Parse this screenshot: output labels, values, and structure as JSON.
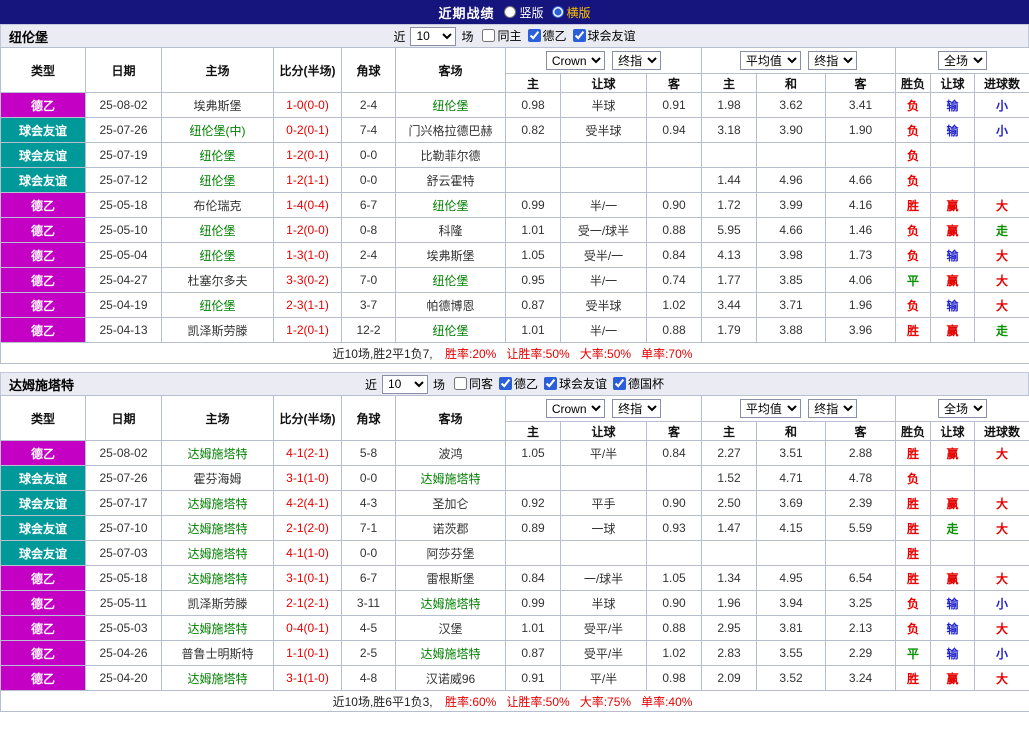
{
  "topbar": {
    "title": "近期战绩",
    "selected_color": "#ffc000",
    "radios": [
      {
        "key": "vertical",
        "label": "竖版",
        "checked": false
      },
      {
        "key": "horizontal",
        "label": "横版",
        "checked": true
      }
    ]
  },
  "headers": {
    "type": "类型",
    "date": "日期",
    "home": "主场",
    "score": "比分(半场)",
    "corner": "角球",
    "away": "客场",
    "sub": [
      "主",
      "让球",
      "客",
      "主",
      "和",
      "客",
      "胜负",
      "让球",
      "进球数"
    ]
  },
  "colors": {
    "league": {
      "de2": "#c400c4",
      "fr": "#009999"
    },
    "focus": "#008000",
    "score": "#e60000",
    "odds": "#333333",
    "red": "#e60000",
    "blue": "#2222cc",
    "green": "#089000"
  },
  "sections": [
    {
      "team": "纽伦堡",
      "filter": {
        "prefix": "近",
        "suffix": "场",
        "count_options": [
          "10"
        ],
        "checkboxes": [
          {
            "label": "同主",
            "checked": false
          },
          {
            "label": "德乙",
            "checked": true
          },
          {
            "label": "球会友谊",
            "checked": true
          }
        ]
      },
      "selects": {
        "bookmaker": [
          "Crown"
        ],
        "final": [
          "终指"
        ],
        "average": [
          "平均值"
        ],
        "final2": [
          "终指"
        ],
        "full": [
          "全场"
        ]
      },
      "rows": [
        {
          "lt": "de2",
          "league": "德乙",
          "date": "25-08-02",
          "home": "埃弗斯堡",
          "hf": false,
          "score": "1-0(0-0)",
          "corner": "2-4",
          "away": "纽伦堡",
          "af": true,
          "ah": "0.98",
          "line": "半球",
          "aa": "0.91",
          "eh": "1.98",
          "ed": "3.62",
          "ea": "3.41",
          "r1": [
            "负",
            "red"
          ],
          "r2": [
            "输",
            "blue"
          ],
          "r3": [
            "小",
            "blue"
          ]
        },
        {
          "lt": "fr",
          "league": "球会友谊",
          "date": "25-07-26",
          "home": "纽伦堡(中)",
          "hf": true,
          "score": "0-2(0-1)",
          "corner": "7-4",
          "away": "门兴格拉德巴赫",
          "af": false,
          "ah": "0.82",
          "line": "受半球",
          "aa": "0.94",
          "eh": "3.18",
          "ed": "3.90",
          "ea": "1.90",
          "r1": [
            "负",
            "red"
          ],
          "r2": [
            "输",
            "blue"
          ],
          "r3": [
            "小",
            "blue"
          ]
        },
        {
          "lt": "fr",
          "league": "球会友谊",
          "date": "25-07-19",
          "home": "纽伦堡",
          "hf": true,
          "score": "1-2(0-1)",
          "corner": "0-0",
          "away": "比勒菲尔德",
          "af": false,
          "ah": "",
          "line": "",
          "aa": "",
          "eh": "",
          "ed": "",
          "ea": "",
          "r1": [
            "负",
            "red"
          ],
          "r2": null,
          "r3": null
        },
        {
          "lt": "fr",
          "league": "球会友谊",
          "date": "25-07-12",
          "home": "纽伦堡",
          "hf": true,
          "score": "1-2(1-1)",
          "corner": "0-0",
          "away": "舒云霍特",
          "af": false,
          "ah": "",
          "line": "",
          "aa": "",
          "eh": "1.44",
          "ed": "4.96",
          "ea": "4.66",
          "r1": [
            "负",
            "red"
          ],
          "r2": null,
          "r3": null
        },
        {
          "lt": "de2",
          "league": "德乙",
          "date": "25-05-18",
          "home": "布伦瑞克",
          "hf": false,
          "score": "1-4(0-4)",
          "corner": "6-7",
          "away": "纽伦堡",
          "af": true,
          "ah": "0.99",
          "line": "半/一",
          "aa": "0.90",
          "eh": "1.72",
          "ed": "3.99",
          "ea": "4.16",
          "r1": [
            "胜",
            "red"
          ],
          "r2": [
            "赢",
            "red"
          ],
          "r3": [
            "大",
            "red"
          ]
        },
        {
          "lt": "de2",
          "league": "德乙",
          "date": "25-05-10",
          "home": "纽伦堡",
          "hf": true,
          "score": "1-2(0-0)",
          "corner": "0-8",
          "away": "科隆",
          "af": false,
          "ah": "1.01",
          "line": "受一/球半",
          "aa": "0.88",
          "eh": "5.95",
          "ed": "4.66",
          "ea": "1.46",
          "r1": [
            "负",
            "red"
          ],
          "r2": [
            "赢",
            "red"
          ],
          "r3": [
            "走",
            "green"
          ]
        },
        {
          "lt": "de2",
          "league": "德乙",
          "date": "25-05-04",
          "home": "纽伦堡",
          "hf": true,
          "score": "1-3(1-0)",
          "corner": "2-4",
          "away": "埃弗斯堡",
          "af": false,
          "ah": "1.05",
          "line": "受半/一",
          "aa": "0.84",
          "eh": "4.13",
          "ed": "3.98",
          "ea": "1.73",
          "r1": [
            "负",
            "red"
          ],
          "r2": [
            "输",
            "blue"
          ],
          "r3": [
            "大",
            "red"
          ]
        },
        {
          "lt": "de2",
          "league": "德乙",
          "date": "25-04-27",
          "home": "杜塞尔多夫",
          "hf": false,
          "score": "3-3(0-2)",
          "corner": "7-0",
          "away": "纽伦堡",
          "af": true,
          "ah": "0.95",
          "line": "半/一",
          "aa": "0.74",
          "eh": "1.77",
          "ed": "3.85",
          "ea": "4.06",
          "r1": [
            "平",
            "green"
          ],
          "r2": [
            "赢",
            "red"
          ],
          "r3": [
            "大",
            "red"
          ]
        },
        {
          "lt": "de2",
          "league": "德乙",
          "date": "25-04-19",
          "home": "纽伦堡",
          "hf": true,
          "score": "2-3(1-1)",
          "corner": "3-7",
          "away": "帕德博恩",
          "af": false,
          "ah": "0.87",
          "line": "受半球",
          "aa": "1.02",
          "eh": "3.44",
          "ed": "3.71",
          "ea": "1.96",
          "r1": [
            "负",
            "red"
          ],
          "r2": [
            "输",
            "blue"
          ],
          "r3": [
            "大",
            "red"
          ]
        },
        {
          "lt": "de2",
          "league": "德乙",
          "date": "25-04-13",
          "home": "凯泽斯劳滕",
          "hf": false,
          "score": "1-2(0-1)",
          "corner": "12-2",
          "away": "纽伦堡",
          "af": true,
          "ah": "1.01",
          "line": "半/一",
          "aa": "0.88",
          "eh": "1.79",
          "ed": "3.88",
          "ea": "3.96",
          "r1": [
            "胜",
            "red"
          ],
          "r2": [
            "赢",
            "red"
          ],
          "r3": [
            "走",
            "green"
          ]
        }
      ],
      "summary": {
        "lead": "近10场,胜2平1负7,",
        "stats": [
          "胜率:20%",
          "让胜率:50%",
          "大率:50%",
          "单率:70%"
        ]
      }
    },
    {
      "team": "达姆施塔特",
      "filter": {
        "prefix": "近",
        "suffix": "场",
        "count_options": [
          "10"
        ],
        "checkboxes": [
          {
            "label": "同客",
            "checked": false
          },
          {
            "label": "德乙",
            "checked": true
          },
          {
            "label": "球会友谊",
            "checked": true
          },
          {
            "label": "德国杯",
            "checked": true
          }
        ]
      },
      "selects": {
        "bookmaker": [
          "Crown"
        ],
        "final": [
          "终指"
        ],
        "average": [
          "平均值"
        ],
        "final2": [
          "终指"
        ],
        "full": [
          "全场"
        ]
      },
      "rows": [
        {
          "lt": "de2",
          "league": "德乙",
          "date": "25-08-02",
          "home": "达姆施塔特",
          "hf": true,
          "score": "4-1(2-1)",
          "corner": "5-8",
          "away": "波鸿",
          "af": false,
          "ah": "1.05",
          "line": "平/半",
          "aa": "0.84",
          "eh": "2.27",
          "ed": "3.51",
          "ea": "2.88",
          "r1": [
            "胜",
            "red"
          ],
          "r2": [
            "赢",
            "red"
          ],
          "r3": [
            "大",
            "red"
          ]
        },
        {
          "lt": "fr",
          "league": "球会友谊",
          "date": "25-07-26",
          "home": "霍芬海姆",
          "hf": false,
          "score": "3-1(1-0)",
          "corner": "0-0",
          "away": "达姆施塔特",
          "af": true,
          "ah": "",
          "line": "",
          "aa": "",
          "eh": "1.52",
          "ed": "4.71",
          "ea": "4.78",
          "r1": [
            "负",
            "red"
          ],
          "r2": null,
          "r3": null
        },
        {
          "lt": "fr",
          "league": "球会友谊",
          "date": "25-07-17",
          "home": "达姆施塔特",
          "hf": true,
          "score": "4-2(4-1)",
          "corner": "4-3",
          "away": "圣加仑",
          "af": false,
          "ah": "0.92",
          "line": "平手",
          "aa": "0.90",
          "eh": "2.50",
          "ed": "3.69",
          "ea": "2.39",
          "r1": [
            "胜",
            "red"
          ],
          "r2": [
            "赢",
            "red"
          ],
          "r3": [
            "大",
            "red"
          ]
        },
        {
          "lt": "fr",
          "league": "球会友谊",
          "date": "25-07-10",
          "home": "达姆施塔特",
          "hf": true,
          "score": "2-1(2-0)",
          "corner": "7-1",
          "away": "诺茨郡",
          "af": false,
          "ah": "0.89",
          "line": "一球",
          "aa": "0.93",
          "eh": "1.47",
          "ed": "4.15",
          "ea": "5.59",
          "r1": [
            "胜",
            "red"
          ],
          "r2": [
            "走",
            "green"
          ],
          "r3": [
            "大",
            "red"
          ]
        },
        {
          "lt": "fr",
          "league": "球会友谊",
          "date": "25-07-03",
          "home": "达姆施塔特",
          "hf": true,
          "score": "4-1(1-0)",
          "corner": "0-0",
          "away": "阿莎芬堡",
          "af": false,
          "ah": "",
          "line": "",
          "aa": "",
          "eh": "",
          "ed": "",
          "ea": "",
          "r1": [
            "胜",
            "red"
          ],
          "r2": null,
          "r3": null
        },
        {
          "lt": "de2",
          "league": "德乙",
          "date": "25-05-18",
          "home": "达姆施塔特",
          "hf": true,
          "score": "3-1(0-1)",
          "corner": "6-7",
          "away": "雷根斯堡",
          "af": false,
          "ah": "0.84",
          "line": "一/球半",
          "aa": "1.05",
          "eh": "1.34",
          "ed": "4.95",
          "ea": "6.54",
          "r1": [
            "胜",
            "red"
          ],
          "r2": [
            "赢",
            "red"
          ],
          "r3": [
            "大",
            "red"
          ]
        },
        {
          "lt": "de2",
          "league": "德乙",
          "date": "25-05-11",
          "home": "凯泽斯劳滕",
          "hf": false,
          "score": "2-1(2-1)",
          "corner": "3-11",
          "away": "达姆施塔特",
          "af": true,
          "ah": "0.99",
          "line": "半球",
          "aa": "0.90",
          "eh": "1.96",
          "ed": "3.94",
          "ea": "3.25",
          "r1": [
            "负",
            "red"
          ],
          "r2": [
            "输",
            "blue"
          ],
          "r3": [
            "小",
            "blue"
          ]
        },
        {
          "lt": "de2",
          "league": "德乙",
          "date": "25-05-03",
          "home": "达姆施塔特",
          "hf": true,
          "score": "0-4(0-1)",
          "corner": "4-5",
          "away": "汉堡",
          "af": false,
          "ah": "1.01",
          "line": "受平/半",
          "aa": "0.88",
          "eh": "2.95",
          "ed": "3.81",
          "ea": "2.13",
          "r1": [
            "负",
            "red"
          ],
          "r2": [
            "输",
            "blue"
          ],
          "r3": [
            "大",
            "red"
          ]
        },
        {
          "lt": "de2",
          "league": "德乙",
          "date": "25-04-26",
          "home": "普鲁士明斯特",
          "hf": false,
          "score": "1-1(0-1)",
          "corner": "2-5",
          "away": "达姆施塔特",
          "af": true,
          "ah": "0.87",
          "line": "受平/半",
          "aa": "1.02",
          "eh": "2.83",
          "ed": "3.55",
          "ea": "2.29",
          "r1": [
            "平",
            "green"
          ],
          "r2": [
            "输",
            "blue"
          ],
          "r3": [
            "小",
            "blue"
          ]
        },
        {
          "lt": "de2",
          "league": "德乙",
          "date": "25-04-20",
          "home": "达姆施塔特",
          "hf": true,
          "score": "3-1(1-0)",
          "corner": "4-8",
          "away": "汉诺威96",
          "af": false,
          "ah": "0.91",
          "line": "平/半",
          "aa": "0.98",
          "eh": "2.09",
          "ed": "3.52",
          "ea": "3.24",
          "r1": [
            "胜",
            "red"
          ],
          "r2": [
            "赢",
            "red"
          ],
          "r3": [
            "大",
            "red"
          ]
        }
      ],
      "summary": {
        "lead": "近10场,胜6平1负3,",
        "stats": [
          "胜率:60%",
          "让胜率:50%",
          "大率:75%",
          "单率:40%"
        ]
      }
    }
  ]
}
